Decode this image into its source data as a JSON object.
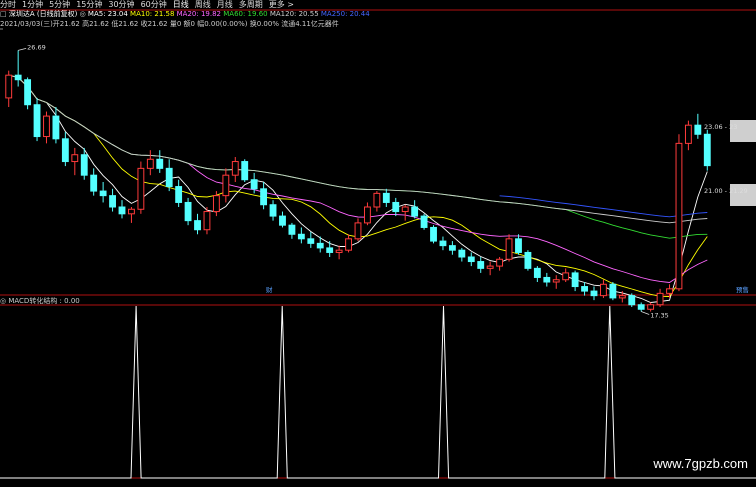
{
  "toolbar": {
    "items": [
      "分时",
      "1分钟",
      "5分钟",
      "15分钟",
      "30分钟",
      "60分钟",
      "日线",
      "周线",
      "月线",
      "多周期",
      "更多 >"
    ],
    "active_index": 6,
    "checkbox_icon": "checkbox-icon"
  },
  "stock": {
    "name": "深圳达A (日线前复权)",
    "ma_items": [
      {
        "label": "MA5: 23.04",
        "color": "#ffffff"
      },
      {
        "label": "MA10: 21.58",
        "color": "#ffff00"
      },
      {
        "label": "MA20: 19.82",
        "color": "#ff66ff"
      },
      {
        "label": "MA60: 19.60",
        "color": "#33dd33"
      },
      {
        "label": "MA120: 20.55",
        "color": "#cccccc"
      },
      {
        "label": "MA250: 20.44",
        "color": "#4466ff"
      }
    ],
    "ohlc_line": "2021/03/03(三)开21.62 高21.62 低21.62 收21.62 量0 额0 幅0.00(0.00%) 换0.00% 流通4.11亿元器件"
  },
  "colors": {
    "up": "#ff3b3b",
    "down": "#54ffff",
    "bg": "#000000",
    "border": "#b01010",
    "ma5": "#ffffff",
    "ma10": "#ffff00",
    "ma20": "#ff66ff",
    "ma60": "#33dd33",
    "ma120": "#cccccc",
    "ma250": "#3355ff"
  },
  "chart_data": [
    {
      "type": "candlestick",
      "title": "",
      "annotations": [
        {
          "text": "26.69",
          "kind": "high-marker"
        },
        {
          "text": "17.35",
          "kind": "low-marker"
        }
      ],
      "right_labels": [
        {
          "text": "23.06 - 23"
        },
        {
          "text": "21.00 - 21.29"
        }
      ],
      "badges": [
        "财",
        "预售"
      ],
      "ylim": [
        16.5,
        27.5
      ],
      "candles": [
        [
          24.6,
          25.8,
          24.2,
          25.6
        ],
        [
          25.6,
          26.69,
          25.1,
          25.4
        ],
        [
          25.4,
          25.5,
          24.1,
          24.3
        ],
        [
          24.3,
          24.6,
          22.7,
          22.9
        ],
        [
          22.9,
          24.0,
          22.6,
          23.8
        ],
        [
          23.8,
          24.2,
          22.6,
          22.8
        ],
        [
          22.8,
          23.1,
          21.6,
          21.8
        ],
        [
          21.8,
          22.4,
          21.2,
          22.1
        ],
        [
          22.1,
          22.4,
          21.0,
          21.2
        ],
        [
          21.2,
          21.5,
          20.3,
          20.5
        ],
        [
          20.5,
          20.9,
          20.0,
          20.3
        ],
        [
          20.3,
          20.6,
          19.6,
          19.8
        ],
        [
          19.8,
          20.1,
          19.3,
          19.5
        ],
        [
          19.5,
          19.8,
          19.1,
          19.7
        ],
        [
          19.7,
          21.8,
          19.5,
          21.5
        ],
        [
          21.5,
          22.3,
          21.2,
          21.9
        ],
        [
          21.9,
          22.3,
          21.3,
          21.5
        ],
        [
          21.5,
          21.9,
          20.5,
          20.7
        ],
        [
          20.7,
          21.0,
          19.8,
          20.0
        ],
        [
          20.0,
          20.2,
          19.0,
          19.2
        ],
        [
          19.2,
          19.5,
          18.6,
          18.8
        ],
        [
          18.8,
          19.8,
          18.6,
          19.6
        ],
        [
          19.6,
          20.5,
          19.4,
          20.3
        ],
        [
          20.3,
          21.5,
          20.0,
          21.2
        ],
        [
          21.2,
          22.0,
          20.9,
          21.8
        ],
        [
          21.8,
          21.9,
          20.9,
          21.0
        ],
        [
          21.0,
          21.3,
          20.4,
          20.6
        ],
        [
          20.6,
          20.9,
          19.7,
          19.9
        ],
        [
          19.9,
          20.1,
          19.2,
          19.4
        ],
        [
          19.4,
          19.6,
          18.9,
          19.0
        ],
        [
          19.0,
          19.1,
          18.4,
          18.6
        ],
        [
          18.6,
          18.9,
          18.2,
          18.4
        ],
        [
          18.4,
          18.7,
          18.0,
          18.2
        ],
        [
          18.2,
          18.5,
          17.8,
          18.0
        ],
        [
          18.0,
          18.3,
          17.6,
          17.8
        ],
        [
          17.8,
          18.1,
          17.5,
          17.9
        ],
        [
          17.9,
          18.6,
          17.8,
          18.4
        ],
        [
          18.4,
          19.3,
          18.3,
          19.1
        ],
        [
          19.1,
          20.0,
          19.0,
          19.8
        ],
        [
          19.8,
          20.5,
          19.6,
          20.4
        ],
        [
          20.4,
          20.6,
          19.8,
          20.0
        ],
        [
          20.0,
          20.2,
          19.4,
          19.6
        ],
        [
          19.6,
          19.9,
          19.2,
          19.8
        ],
        [
          19.8,
          20.1,
          19.3,
          19.4
        ],
        [
          19.4,
          19.5,
          18.8,
          18.9
        ],
        [
          18.9,
          19.0,
          18.2,
          18.3
        ],
        [
          18.3,
          18.5,
          17.9,
          18.1
        ],
        [
          18.1,
          18.3,
          17.7,
          17.9
        ],
        [
          17.9,
          18.0,
          17.4,
          17.6
        ],
        [
          17.6,
          17.8,
          17.2,
          17.4
        ],
        [
          17.4,
          17.6,
          16.9,
          17.1
        ],
        [
          17.1,
          17.4,
          16.8,
          17.2
        ],
        [
          17.2,
          17.6,
          17.0,
          17.5
        ],
        [
          17.5,
          18.6,
          17.4,
          18.4
        ],
        [
          18.4,
          18.6,
          17.7,
          17.8
        ],
        [
          17.8,
          17.9,
          17.0,
          17.1
        ],
        [
          17.1,
          17.2,
          16.5,
          16.7
        ],
        [
          16.7,
          16.9,
          16.3,
          16.5
        ],
        [
          16.5,
          16.8,
          16.2,
          16.6
        ],
        [
          16.6,
          17.1,
          16.5,
          16.9
        ],
        [
          16.9,
          17.0,
          16.1,
          16.3
        ],
        [
          16.3,
          16.5,
          15.9,
          16.1
        ],
        [
          16.1,
          16.3,
          15.7,
          15.9
        ],
        [
          15.9,
          16.6,
          15.8,
          16.4
        ],
        [
          16.4,
          16.5,
          15.7,
          15.8
        ],
        [
          15.8,
          16.1,
          15.6,
          15.9
        ],
        [
          15.9,
          16.0,
          15.4,
          15.5
        ],
        [
          15.5,
          15.6,
          15.2,
          15.3
        ],
        [
          15.3,
          15.6,
          15.2,
          15.5
        ],
        [
          15.5,
          16.2,
          15.4,
          16.0
        ],
        [
          16.0,
          16.4,
          15.8,
          16.2
        ],
        [
          16.2,
          23.0,
          16.1,
          22.6
        ],
        [
          22.6,
          23.6,
          22.3,
          23.4
        ],
        [
          23.4,
          23.9,
          22.8,
          23.0
        ],
        [
          23.0,
          23.2,
          21.4,
          21.62
        ]
      ]
    },
    {
      "type": "line",
      "title": "MACD转化结构 : 0.00",
      "ylim": [
        0,
        1
      ],
      "x": [
        0,
        26,
        27,
        28,
        55,
        56,
        57,
        87,
        88,
        89,
        120,
        121,
        122,
        150
      ],
      "values": [
        0,
        0,
        1,
        0,
        0,
        1,
        0,
        0,
        1,
        0,
        0,
        1,
        0,
        0
      ]
    }
  ],
  "watermark": "www.7gpzb.com"
}
